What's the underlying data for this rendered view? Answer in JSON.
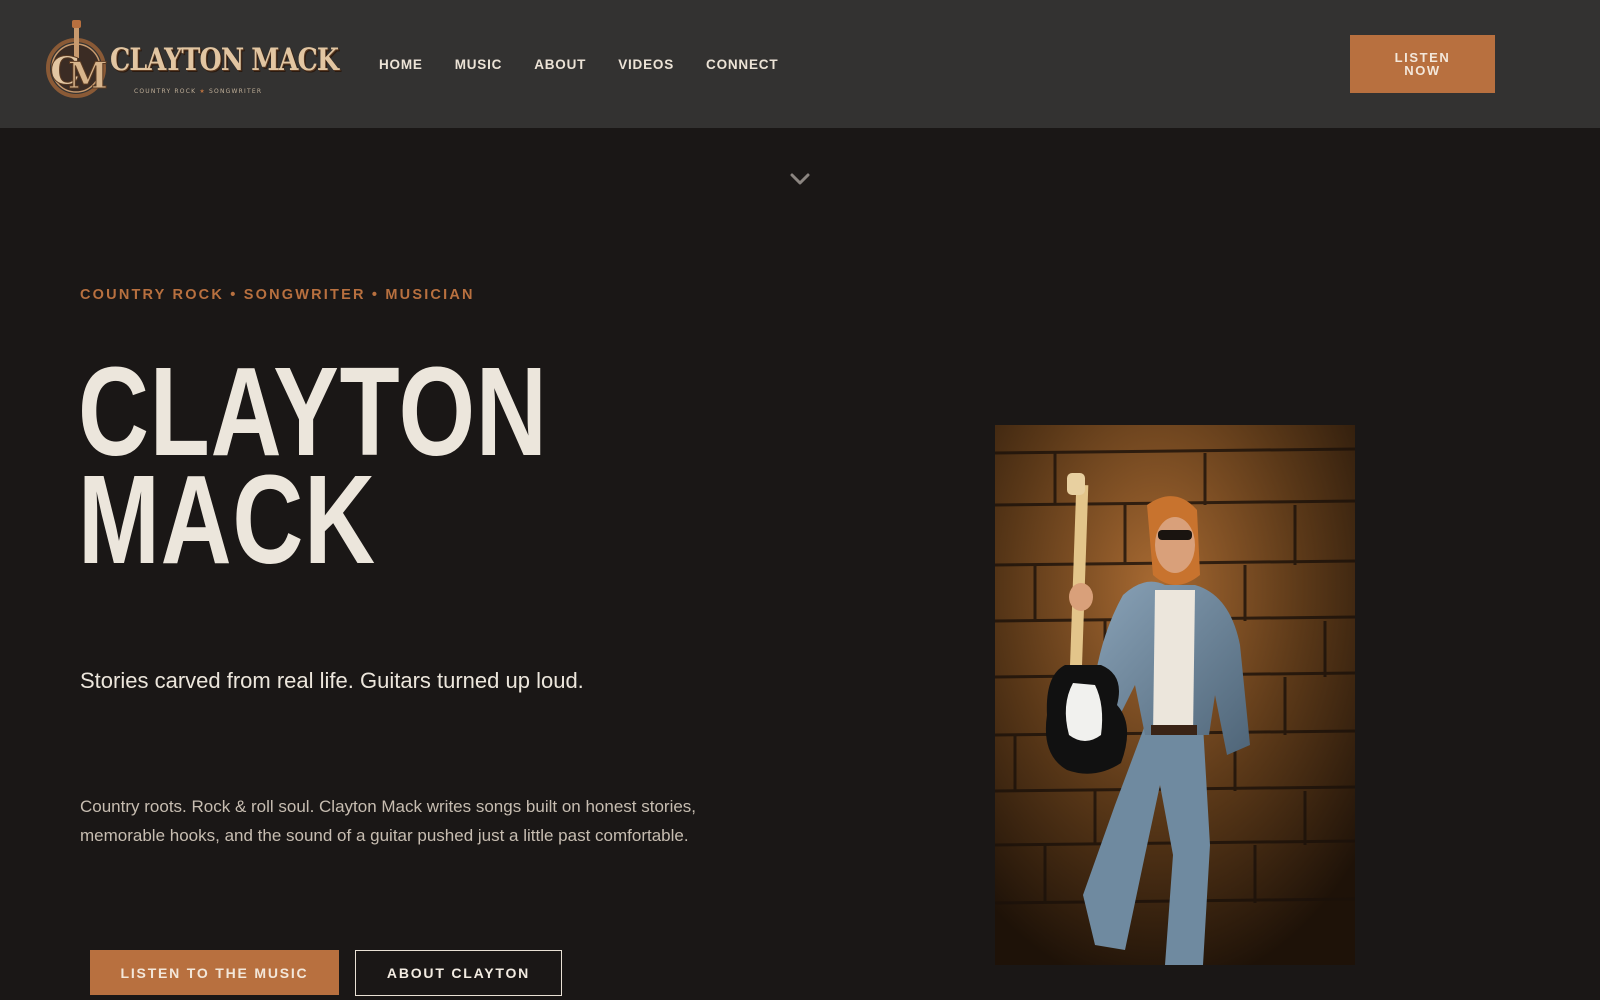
{
  "logo": {
    "monogram": "CM",
    "name": "CLAYTON MACK",
    "tagline_left": "COUNTRY ROCK",
    "tagline_right": "SONGWRITER"
  },
  "nav": {
    "items": [
      {
        "label": "HOME"
      },
      {
        "label": "MUSIC"
      },
      {
        "label": "ABOUT"
      },
      {
        "label": "VIDEOS"
      },
      {
        "label": "CONNECT"
      }
    ],
    "cta_label": "LISTEN NOW"
  },
  "hero": {
    "eyebrow": "COUNTRY ROCK • SONGWRITER • MUSICIAN",
    "title_line1": "CLAYTON",
    "title_line2": "MACK",
    "tagline": "Stories carved from real life. Guitars turned up loud.",
    "bio": "Country roots. Rock & roll soul. Clayton Mack writes songs built on honest stories, memorable hooks, and the sound of a guitar pushed just a little past comfortable.",
    "primary_button": "LISTEN TO THE MUSIC",
    "secondary_button": "ABOUT CLAYTON"
  },
  "icons": {
    "scroll": "chevron-down-icon",
    "logo_mark": "guitar-monogram-icon"
  },
  "colors": {
    "accent": "#b8703f",
    "background": "#1a1716",
    "header": "#333231",
    "text_light": "#ece6dc"
  }
}
